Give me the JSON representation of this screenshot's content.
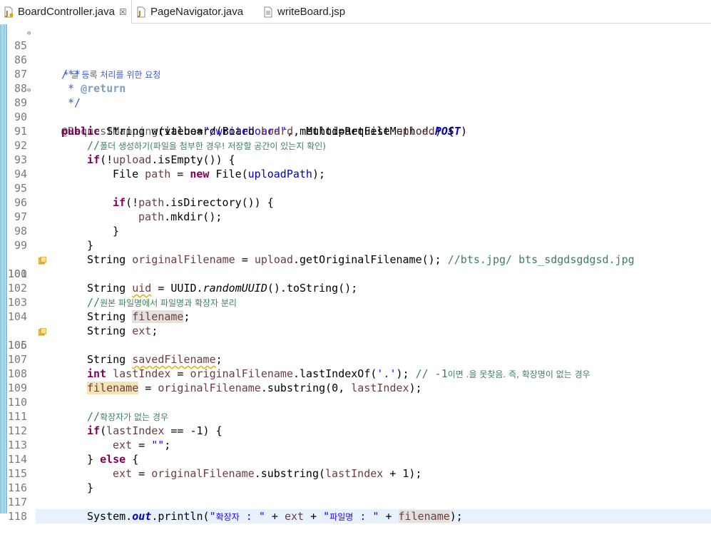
{
  "tabs": [
    {
      "label": "BoardController.java",
      "close": "☒",
      "active": true
    },
    {
      "label": "PageNavigator.java",
      "active": false
    },
    {
      "label": "writeBoard.jsp",
      "active": false
    }
  ],
  "colors": {
    "keyword": "#7f0055",
    "string": "#2a00ff",
    "comment": "#3f7f5f",
    "javadoc": "#3f5fbf",
    "field": "#0000c0",
    "local_variable": "#6a3e3e",
    "current_line": "#e8f2fe"
  },
  "editor": {
    "lines": {
      "l85": "85",
      "l86": "86",
      "l87": "87",
      "l88": "88",
      "l89": "89",
      "l90": "90",
      "l91": "91",
      "l92": "92",
      "l93": "93",
      "l94": "94",
      "l95": "95",
      "l96": "96",
      "l97": "97",
      "l98": "98",
      "l99": "99",
      "l100": "100",
      "l101": "101",
      "l102": "102",
      "l103": "103",
      "l104": "104",
      "l105": "105",
      "l106": "106",
      "l107": "107",
      "l108": "108",
      "l109": "109",
      "l110": "110",
      "l111": "111",
      "l112": "112",
      "l113": "113",
      "l114": "114",
      "l115": "115",
      "l116": "116",
      "l117": "117",
      "l118": "118"
    },
    "code": {
      "c85": "/**",
      "c86": " * 글 등록 처리를 위한 요청",
      "c87a": " * ",
      "c87b": "@return",
      "c88": " */",
      "c89a": "@RequestMapping",
      "c89b": "(value=",
      "c89c": "\"/writeboard\"",
      "c89d": ", method=RequestMethod.",
      "c89e": "POST",
      "c89f": ")",
      "c90a": "public",
      "c90b": " String writeboard(Board ",
      "c90c": "board",
      "c90d": ", MultipartFile ",
      "c90e": "upload",
      "c90f": ") {",
      "c91a": "//",
      "c91b": "폴더 생성하기(파일을 첨부한 경우! 저장할 공간이 있는지 확인)",
      "c92a": "if",
      "c92b": "(!",
      "c92c": "upload",
      "c92d": ".isEmpty()) {",
      "c93a": "File ",
      "c93b": "path",
      "c93c": " = ",
      "c93d": "new",
      "c93e": " File(",
      "c93f": "uploadPath",
      "c93g": ");",
      "c95a": "if",
      "c95b": "(!",
      "c95c": "path",
      "c95d": ".isDirectory()) {",
      "c96a": "path",
      "c96b": ".mkdir();",
      "c97": "}",
      "c98": "}",
      "c99a": "String ",
      "c99b": "originalFilename",
      "c99c": " = ",
      "c99d": "upload",
      "c99e": ".getOriginalFilename(); ",
      "c99f": "//bts.jpg/ bts_sdgdsgdgsd.jpg",
      "c100a": "String ",
      "c100b": "uid",
      "c100c": " = UUID.",
      "c100d": "randomUUID",
      "c100e": "().toString();",
      "c102a": "//",
      "c102b": "원본 파일명에서 파일명과 확장자 분리",
      "c103a": "String ",
      "c103b": "filename",
      "c103c": ";",
      "c104a": "String ",
      "c104b": "ext",
      "c104c": ";",
      "c105a": "String ",
      "c105b": "savedFilename",
      "c105c": ";",
      "c107a": "int",
      "c107b": " ",
      "c107c": "lastIndex",
      "c107d": " = ",
      "c107e": "originalFilename",
      "c107f": ".lastIndexOf(",
      "c107g": "'.'",
      "c107h": "); ",
      "c107i": "// -1",
      "c107j": "이면 .을 못찾음. 즉, 확장명이 없는 경우",
      "c108a": "filename",
      "c108b": " = ",
      "c108c": "originalFilename",
      "c108d": ".substring(0, ",
      "c108e": "lastIndex",
      "c108f": ");",
      "c110a": "//",
      "c110b": "확장자가 없는 경우",
      "c111a": "if",
      "c111b": "(",
      "c111c": "lastIndex",
      "c111d": " == -1) {",
      "c112a": "ext",
      "c112b": " = ",
      "c112c": "\"\"",
      "c112d": ";",
      "c113a": "} ",
      "c113b": "else",
      "c113c": " {",
      "c114a": "ext",
      "c114b": " = ",
      "c114c": "originalFilename",
      "c114d": ".substring(",
      "c114e": "lastIndex",
      "c114f": " + 1);",
      "c115": "}",
      "c117a": "System.",
      "c117b": "out",
      "c117c": ".println(",
      "c117d": "\"",
      "c117e": "확장자",
      "c117f": " : \"",
      "c117g": " + ",
      "c117h": "ext",
      "c117i": " + ",
      "c117j": "\"",
      "c117k": "파일명",
      "c117l": " : \"",
      "c117m": " + ",
      "c117n": "filename",
      "c117o": ");"
    }
  }
}
